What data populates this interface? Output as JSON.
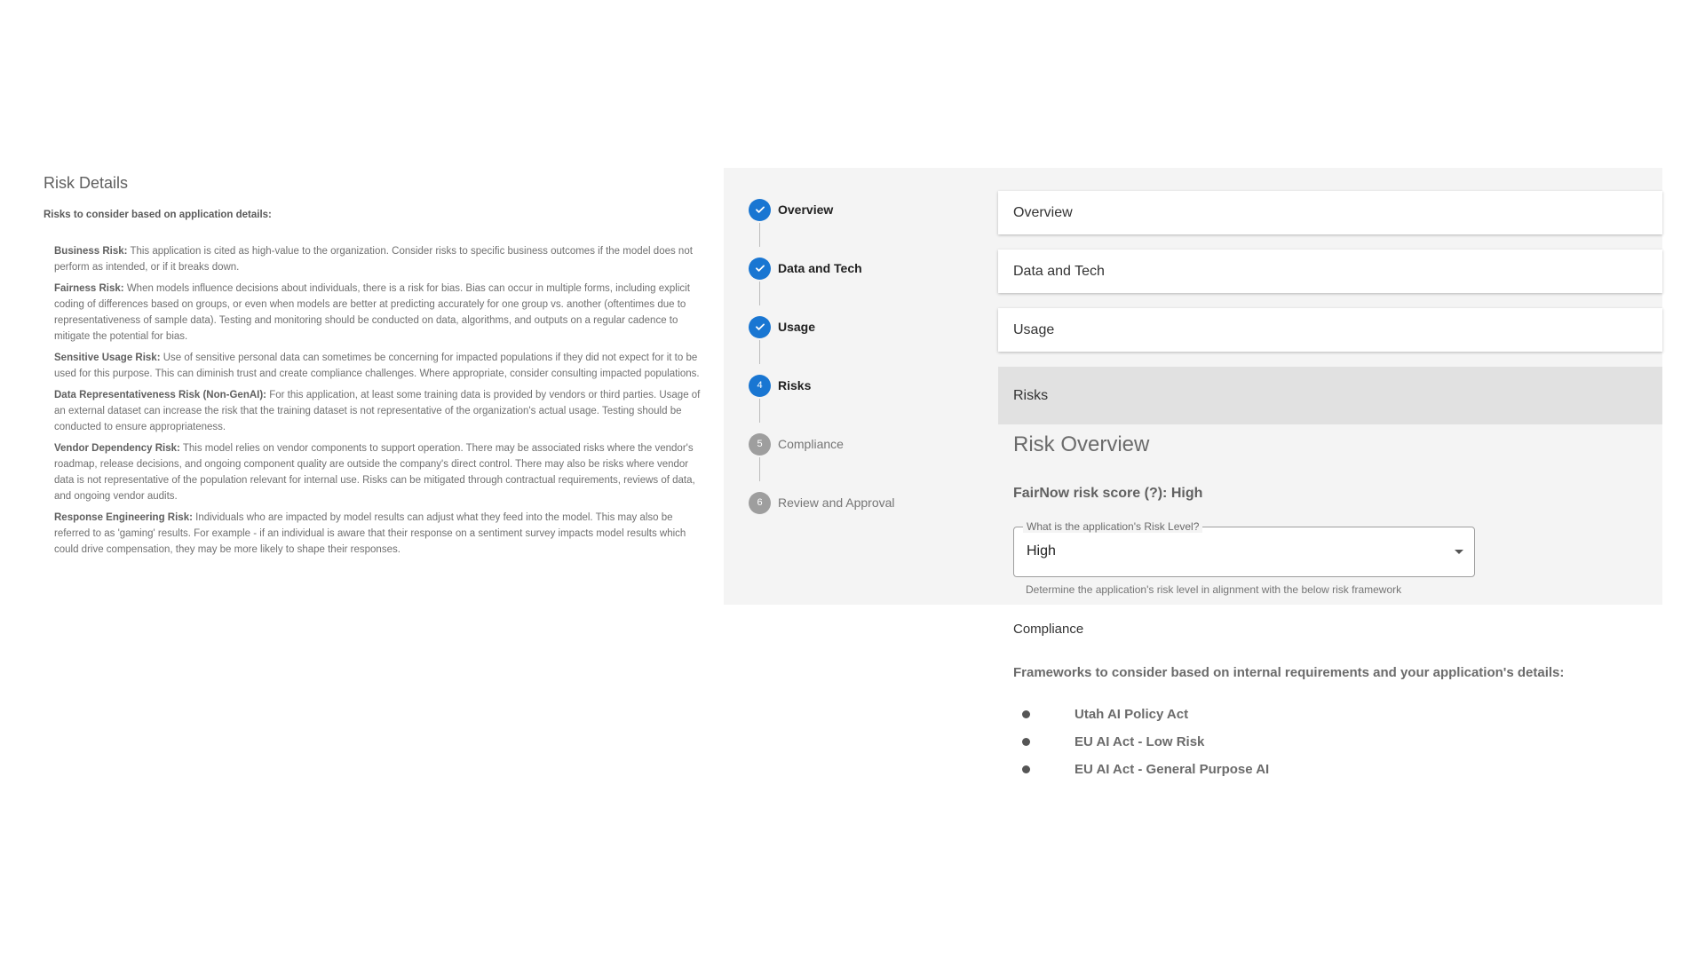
{
  "risk_details": {
    "title": "Risk Details",
    "subtitle": "Risks to consider based on application details:",
    "items": [
      {
        "name": "Business Risk:",
        "text": " This application is cited as high-value to the organization. Consider risks to specific business outcomes if the model does not perform as intended, or if it breaks down."
      },
      {
        "name": "Fairness Risk:",
        "text": " When models influence decisions about individuals, there is a risk for bias. Bias can occur in multiple forms, including explicit coding of differences based on groups, or even when models are better at predicting accurately for one group vs. another (oftentimes due to representativeness of sample data). Testing and monitoring should be conducted on data, algorithms, and outputs on a regular cadence to mitigate the potential for bias."
      },
      {
        "name": "Sensitive Usage Risk:",
        "text": " Use of sensitive personal data can sometimes be concerning for impacted populations if they did not expect for it to be used for this purpose. This can diminish trust and create compliance challenges. Where appropriate, consider consulting impacted populations."
      },
      {
        "name": "Data Representativeness Risk (Non-GenAI):",
        "text": " For this application, at least some training data is provided by vendors or third parties. Usage of an external dataset can increase the risk that the training dataset is not representative of the organization's actual usage. Testing should be conducted to ensure appropriateness."
      },
      {
        "name": "Vendor Dependency Risk:",
        "text": " This model relies on vendor components to support operation. There may be associated risks where the vendor's roadmap, release decisions, and ongoing component quality are outside the company's direct control. There may also be risks where vendor data is not representative of the population relevant for internal use. Risks can be mitigated through contractual requirements, reviews of data, and ongoing vendor audits."
      },
      {
        "name": "Response Engineering Risk:",
        "text": " Individuals who are impacted by model results can adjust what they feed into the model. This may also be referred to as 'gaming' results. For example - if an individual is aware that their response on a sentiment survey impacts model results which could drive compensation, they may be more likely to shape their responses."
      }
    ]
  },
  "stepper": {
    "steps": [
      {
        "label": "Overview",
        "status": "done",
        "number": ""
      },
      {
        "label": "Data and Tech",
        "status": "done",
        "number": ""
      },
      {
        "label": "Usage",
        "status": "done",
        "number": ""
      },
      {
        "label": "Risks",
        "status": "active",
        "number": "4"
      },
      {
        "label": "Compliance",
        "status": "pending",
        "number": "5"
      },
      {
        "label": "Review and Approval",
        "status": "pending",
        "number": "6"
      }
    ]
  },
  "sections": {
    "overview": "Overview",
    "data_tech": "Data and Tech",
    "usage": "Usage",
    "risks": "Risks"
  },
  "risk_overview": {
    "title": "Risk Overview",
    "score": "FairNow risk score (?): High",
    "select_label": "What is the application's Risk Level?",
    "select_value": "High",
    "helper": "Determine the application's risk level in alignment with the below risk framework"
  },
  "compliance": {
    "title": "Compliance",
    "intro": "Frameworks to consider based on internal requirements and your application's details:",
    "frameworks": [
      "Utah AI Policy Act",
      "EU AI Act - Low Risk",
      "EU AI Act - General Purpose AI"
    ]
  },
  "colors": {
    "accent": "#1976d2",
    "pending": "#9e9e9e",
    "panel_bg": "#f4f4f4",
    "active_card": "#e1e1e1"
  }
}
